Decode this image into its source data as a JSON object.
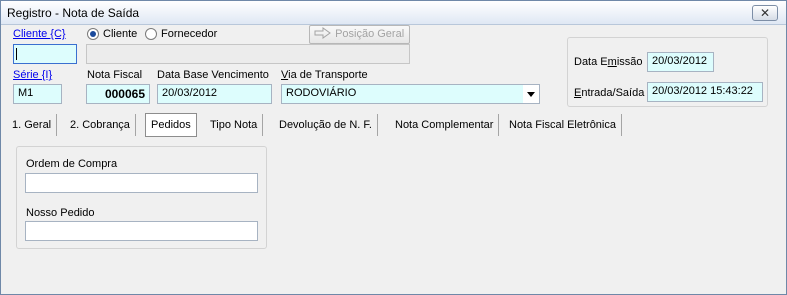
{
  "window": {
    "title": "Registro - Nota de Saída",
    "close_label": "✕"
  },
  "cliente": {
    "label": "Cliente {C}",
    "value": "",
    "radio_cliente": "Cliente",
    "radio_fornecedor": "Fornecedor",
    "radio_selected": "Cliente",
    "name_value": ""
  },
  "posicao_geral": {
    "label": "Posição Geral",
    "icon": "arrow-right-icon"
  },
  "serie": {
    "label": "Série {I}",
    "value": "M1"
  },
  "nota_fiscal": {
    "label": "Nota Fiscal",
    "value": "000065"
  },
  "data_base": {
    "label": "Data Base Vencimento",
    "value": "20/03/2012"
  },
  "via_transporte": {
    "label": "Via de Transporte",
    "value": "RODOVIÁRIO"
  },
  "data_emissao": {
    "label": "Data Emissão",
    "value": "20/03/2012"
  },
  "entrada_saida": {
    "label": "Entrada/Saída",
    "value": "20/03/2012 15:43:22"
  },
  "tabs": [
    {
      "label": "1. Geral"
    },
    {
      "label": "2. Cobrança"
    },
    {
      "label": "Pedidos"
    },
    {
      "label": "Tipo Nota"
    },
    {
      "label": "Devolução de N. F."
    },
    {
      "label": "Nota Complementar"
    },
    {
      "label": "Nota Fiscal Eletrônica"
    }
  ],
  "pedidos": {
    "ordem_label": "Ordem de Compra",
    "ordem_value": "",
    "nosso_label": "Nosso Pedido",
    "nosso_value": ""
  },
  "colors": {
    "field_bg": "#ddfdfd",
    "link": "#0000ee"
  }
}
